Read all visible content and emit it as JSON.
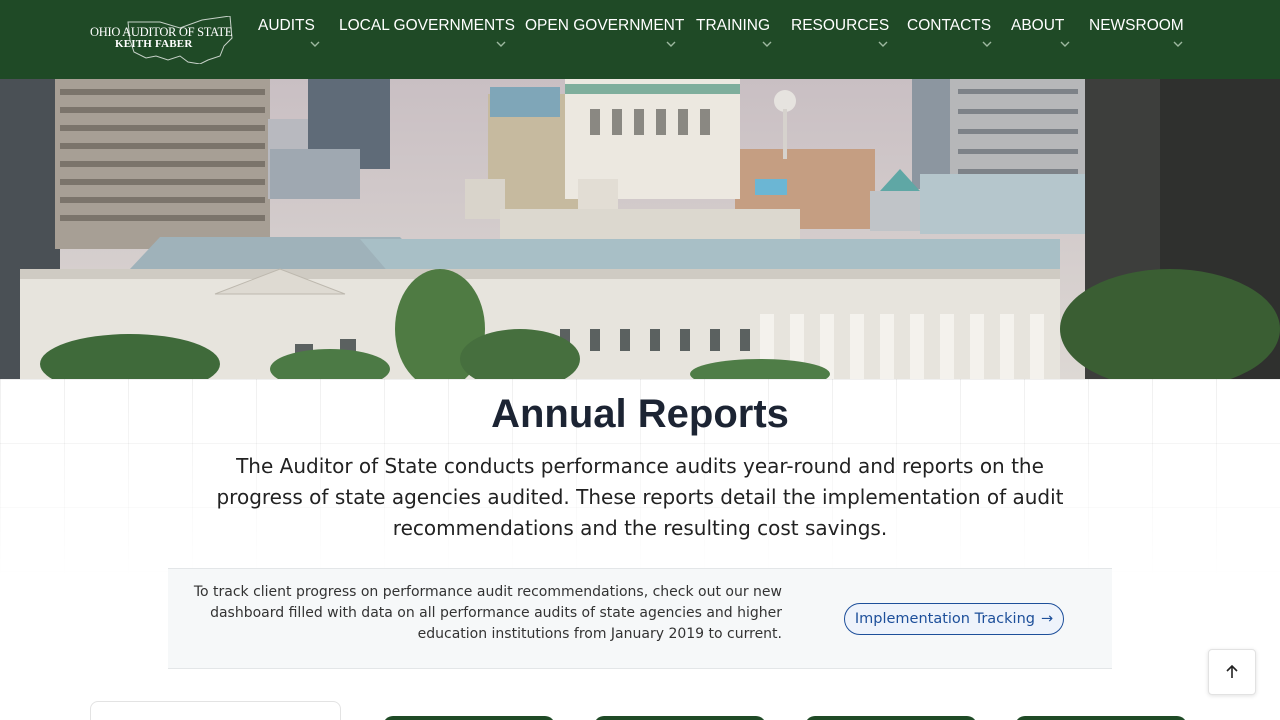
{
  "header": {
    "logo_line1": "OHIO AUDITOR OF STATE",
    "logo_line2": "KEITH FABER",
    "nav": [
      {
        "label": "AUDITS"
      },
      {
        "label": "LOCAL GOVERNMENTS"
      },
      {
        "label": "OPEN GOVERNMENT"
      },
      {
        "label": "TRAINING"
      },
      {
        "label": "RESOURCES"
      },
      {
        "label": "CONTACTS"
      },
      {
        "label": "ABOUT"
      },
      {
        "label": "NEWSROOM"
      }
    ]
  },
  "main": {
    "title": "Annual Reports",
    "description": "The Auditor of State conducts performance audits year-round and reports on the progress of state agencies audited. These reports detail the implementation of audit recommendations and the resulting cost savings.",
    "callout_text": "To track client progress on performance audit recommendations, check out our new dashboard filled with data on all performance audits of state agencies and higher education institutions from January 2019 to current.",
    "tracking_button": "Implementation Tracking",
    "tracking_arrow": "→"
  },
  "colors": {
    "header_bg": "#1f4a26",
    "title": "#1c2433",
    "link_blue": "#1d4f9a"
  },
  "icons": {
    "logo": "ohio-state-outline-icon",
    "nav_chevron": "chevron-down-icon",
    "back_to_top": "arrow-up-icon"
  }
}
